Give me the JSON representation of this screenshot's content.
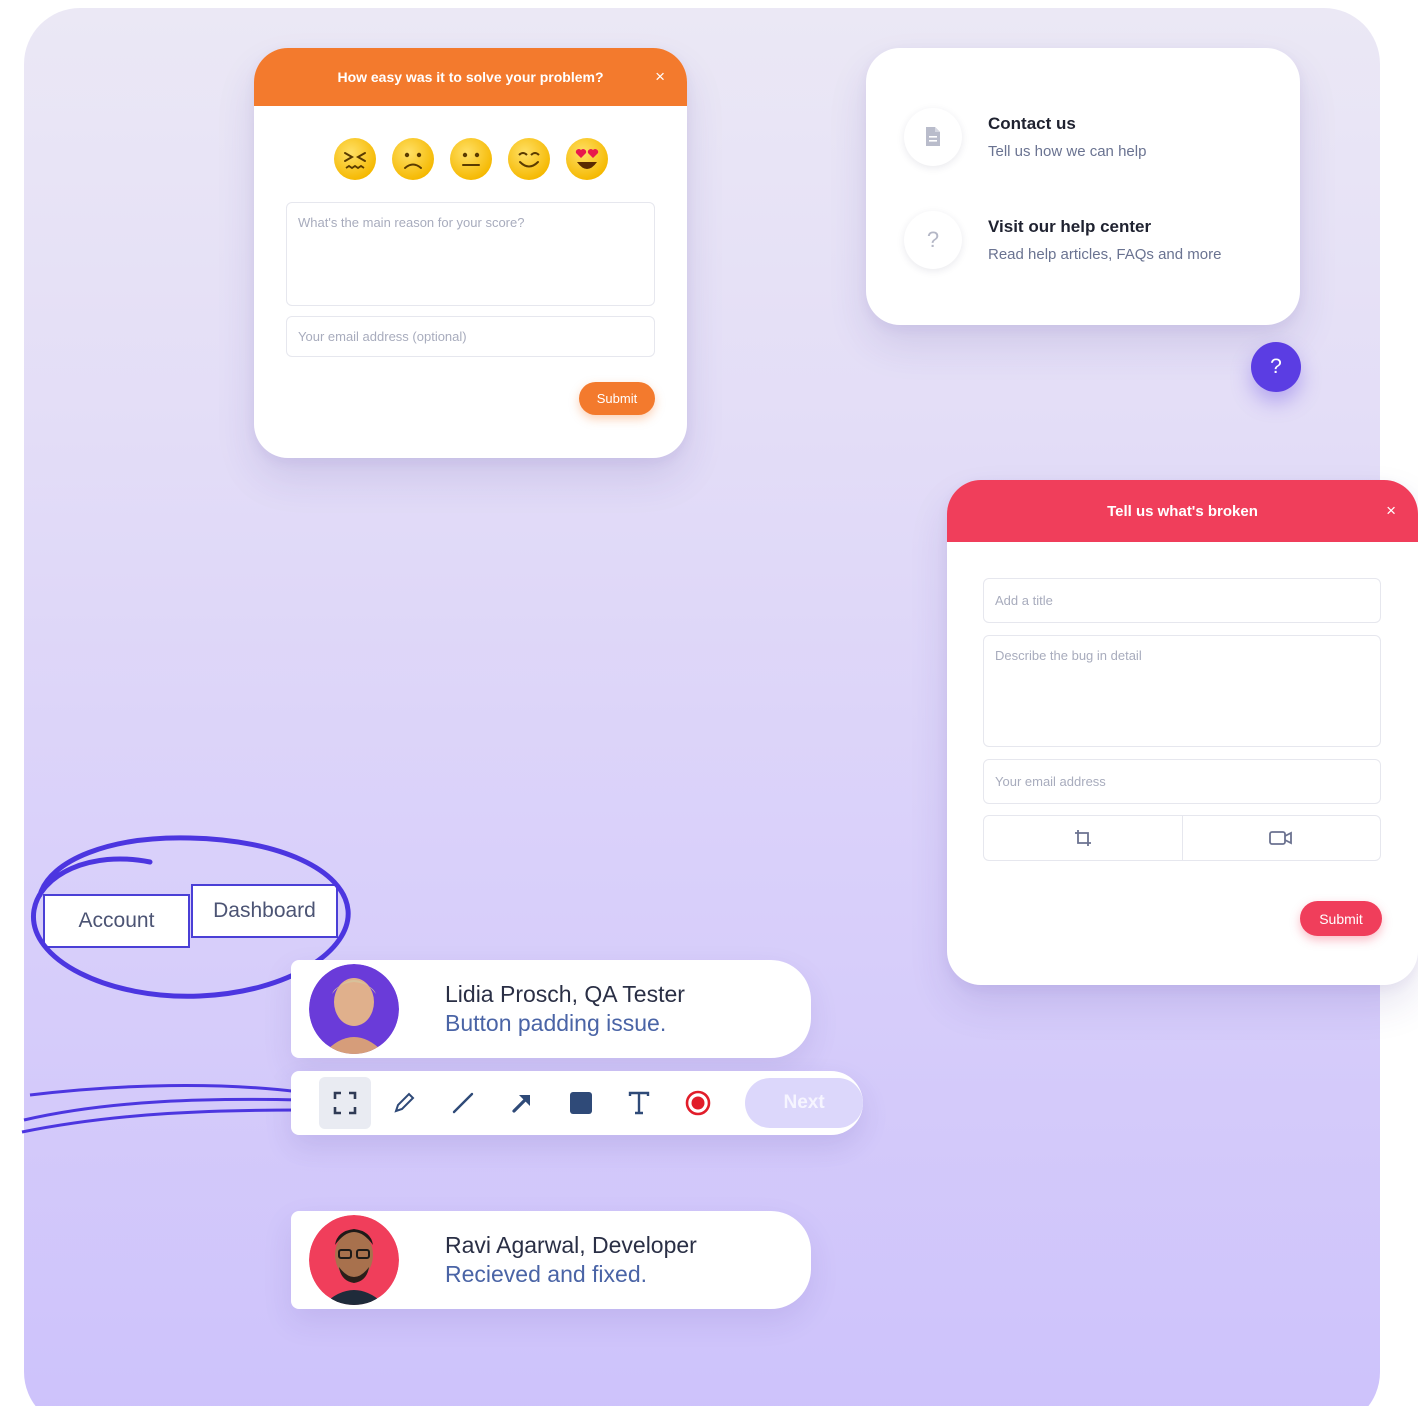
{
  "survey": {
    "title": "How easy was it to solve your problem?",
    "close": "×",
    "emoji_names": [
      "very-hard-emoji",
      "sad-emoji",
      "neutral-emoji",
      "happy-emoji",
      "love-emoji"
    ],
    "reason_placeholder": "What's the main reason for your score?",
    "email_placeholder": "Your email address (optional)",
    "submit": "Submit",
    "accent": "#f37a2d"
  },
  "contact": {
    "items": [
      {
        "icon": "document-icon",
        "title": "Contact us",
        "subtitle": "Tell us how we can help"
      },
      {
        "icon": "question-icon",
        "title": "Visit our help center",
        "subtitle": "Read help articles, FAQs and more"
      }
    ],
    "fab": "?"
  },
  "bug": {
    "title": "Tell us what's broken",
    "close": "×",
    "title_placeholder": "Add a title",
    "desc_placeholder": "Describe the bug in detail",
    "email_placeholder": "Your email address",
    "attach": [
      "crop-icon",
      "video-icon"
    ],
    "submit": "Submit",
    "accent": "#f03e5b"
  },
  "tabs": {
    "account": "Account",
    "dashboard": "Dashboard"
  },
  "comments": [
    {
      "name": "Lidia Prosch, QA Tester",
      "message": "Button padding issue."
    },
    {
      "name": "Ravi Agarwal, Developer",
      "message": "Recieved and fixed."
    }
  ],
  "toolbar": {
    "tools": [
      "select-area-icon",
      "pen-icon",
      "line-icon",
      "arrow-icon",
      "rectangle-icon",
      "text-icon",
      "record-icon"
    ],
    "next": "Next",
    "accent": "#5b3de3"
  }
}
